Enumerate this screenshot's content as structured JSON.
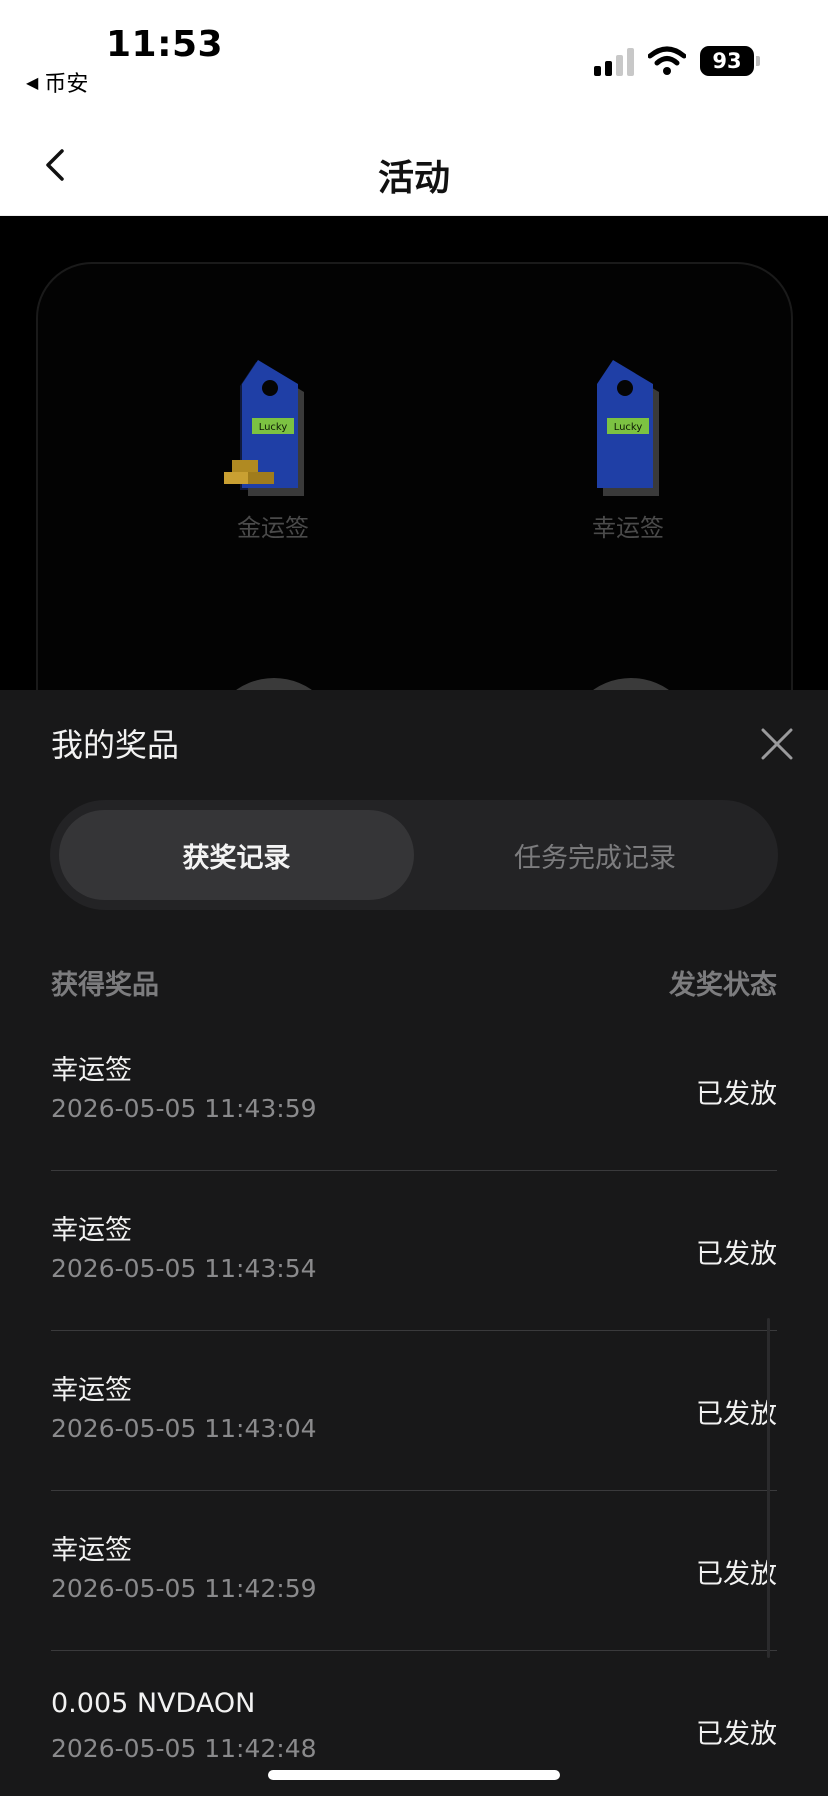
{
  "status_bar": {
    "time": "11:53",
    "back_app": "币安",
    "battery": "93"
  },
  "nav": {
    "title": "活动"
  },
  "rewards": [
    {
      "label": "金运签",
      "icon": "gold-lucky-tag-icon",
      "tag_text": "Lucky"
    },
    {
      "label": "幸运签",
      "icon": "lucky-tag-icon",
      "tag_text": "Lucky"
    }
  ],
  "sheet": {
    "title": "我的奖品",
    "tabs": [
      {
        "label": "获奖记录",
        "active": true
      },
      {
        "label": "任务完成记录",
        "active": false
      }
    ],
    "columns": {
      "prize": "获得奖品",
      "status": "发奖状态"
    },
    "records": [
      {
        "name": "幸运签",
        "time": "2026-05-05 11:43:59",
        "status": "已发放"
      },
      {
        "name": "幸运签",
        "time": "2026-05-05 11:43:54",
        "status": "已发放"
      },
      {
        "name": "幸运签",
        "time": "2026-05-05 11:43:04",
        "status": "已发放"
      },
      {
        "name": "幸运签",
        "time": "2026-05-05 11:42:59",
        "status": "已发放"
      },
      {
        "name": "0.005 NVDAON",
        "time": "2026-05-05 11:42:48",
        "status": "已发放"
      }
    ]
  },
  "colors": {
    "sheet_bg": "#181819",
    "tab_active_bg": "#353537",
    "tag_blue": "#1f3fa6",
    "tag_label_green": "#7cc242",
    "gold": "#c9a032"
  }
}
